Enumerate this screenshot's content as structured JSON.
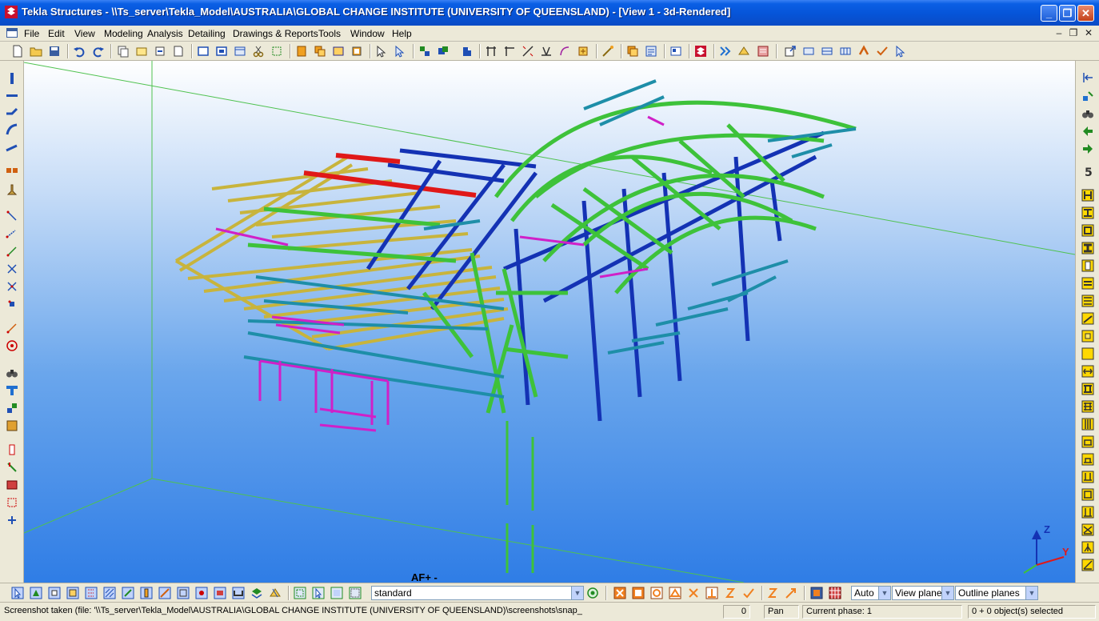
{
  "window": {
    "title": "Tekla Structures - \\\\Ts_server\\Tekla_Model\\AUSTRALIA\\GLOBAL CHANGE INSTITUTE (UNIVERSITY OF QUEENSLAND) - [View 1 - 3d-Rendered]",
    "app_icon": "tekla-logo-icon",
    "minimize_glyph": "_",
    "maximize_glyph": "❐",
    "close_glyph": "✕"
  },
  "menu": {
    "items": [
      "File",
      "Edit",
      "View",
      "Modeling",
      "Analysis",
      "Detailing",
      "Drawings & Reports",
      "Tools",
      "Window",
      "Help"
    ],
    "mdi_minimize": "–",
    "mdi_restore": "❐",
    "mdi_close": "✕"
  },
  "bottom_toolbar": {
    "filter_value": "standard",
    "snap_depth": "Auto",
    "plane": "View plane",
    "planes_display": "Outline planes"
  },
  "viewport": {
    "axis_labels": {
      "z": "Z",
      "y": "Y"
    },
    "partial_label": "AF+ -"
  },
  "status": {
    "message": "Screenshot taken (file: '\\\\Ts_server\\Tekla_Model\\AUSTRALIA\\GLOBAL CHANGE INSTITUTE (UNIVERSITY OF QUEENSLAND)\\screenshots\\snap_",
    "count": "0",
    "mode": "Pan",
    "phase": "Current phase: 1",
    "selection": "0 + 0 object(s) selected"
  },
  "colors": {
    "title_blue": "#0654d8",
    "member_green": "#3ec23a",
    "member_blue": "#1432b4",
    "member_teal": "#1e8ea8",
    "member_magenta": "#d020c8",
    "member_red": "#e01818",
    "member_yellow": "#c8b43c"
  }
}
